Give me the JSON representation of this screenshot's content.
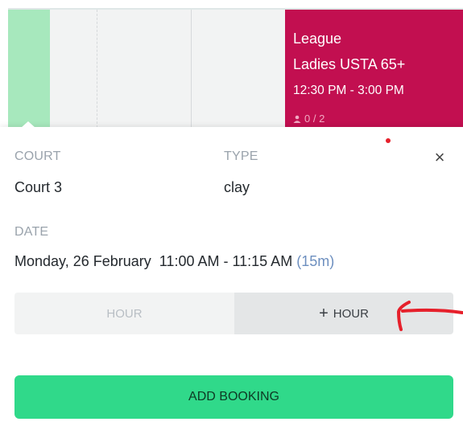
{
  "event": {
    "type": "League",
    "title": "Ladies USTA 65+",
    "time": "12:30 PM - 3:00 PM",
    "slots": "0 / 2"
  },
  "details": {
    "court_label": "COURT",
    "court_value": "Court 3",
    "type_label": "TYPE",
    "type_value": "clay",
    "date_label": "DATE",
    "date_value": "Monday, 26 February  11:00 AM - 11:15 AM",
    "duration": "(15m)",
    "close": "×"
  },
  "hour_toggle": {
    "minus_label": "HOUR",
    "plus_symbol": "+",
    "plus_label": "HOUR"
  },
  "actions": {
    "add_booking_label": "ADD BOOKING"
  },
  "colors": {
    "event_bg": "#c20f50",
    "available_green": "#a7e8bd",
    "primary_button": "#30d98a",
    "annotation_red": "#e6202b"
  }
}
